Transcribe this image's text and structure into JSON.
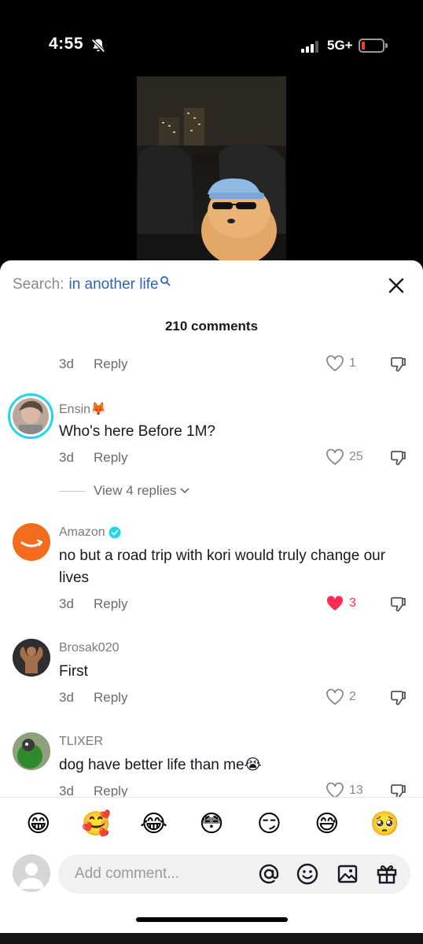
{
  "status_bar": {
    "time": "4:55",
    "network": "5G+",
    "battery_level": 0.1
  },
  "search": {
    "prefix": "Search:",
    "term": "in another life"
  },
  "header": {
    "comment_count": "210 comments"
  },
  "comments": [
    {
      "date": "3d",
      "reply": "Reply",
      "likes": "1",
      "liked": false
    },
    {
      "user": "Ensin🦊",
      "text": "Who's here Before 1M?",
      "date": "3d",
      "reply": "Reply",
      "likes": "25",
      "liked": false,
      "view_replies": "View 4 replies"
    },
    {
      "user": "Amazon",
      "verified": true,
      "text": "no but a road trip with kori would truly change our lives",
      "date": "3d",
      "reply": "Reply",
      "likes": "3",
      "liked": true
    },
    {
      "user": "Brosak020",
      "text": "First",
      "date": "3d",
      "reply": "Reply",
      "likes": "2",
      "liked": false
    },
    {
      "user": "TLIXER",
      "text": "dog have better life than me😭",
      "date": "3d",
      "reply": "Reply",
      "likes": "13",
      "liked": false
    }
  ],
  "emojis": [
    "😁",
    "🥰",
    "😂",
    "😳",
    "😏",
    "😅",
    "🥺"
  ],
  "input": {
    "placeholder": "Add comment..."
  },
  "colors": {
    "accent_blue": "#2e64b5",
    "like_red": "#fe2c55",
    "amazon_orange": "#f36b1c",
    "verified_blue": "#20d5ec"
  }
}
